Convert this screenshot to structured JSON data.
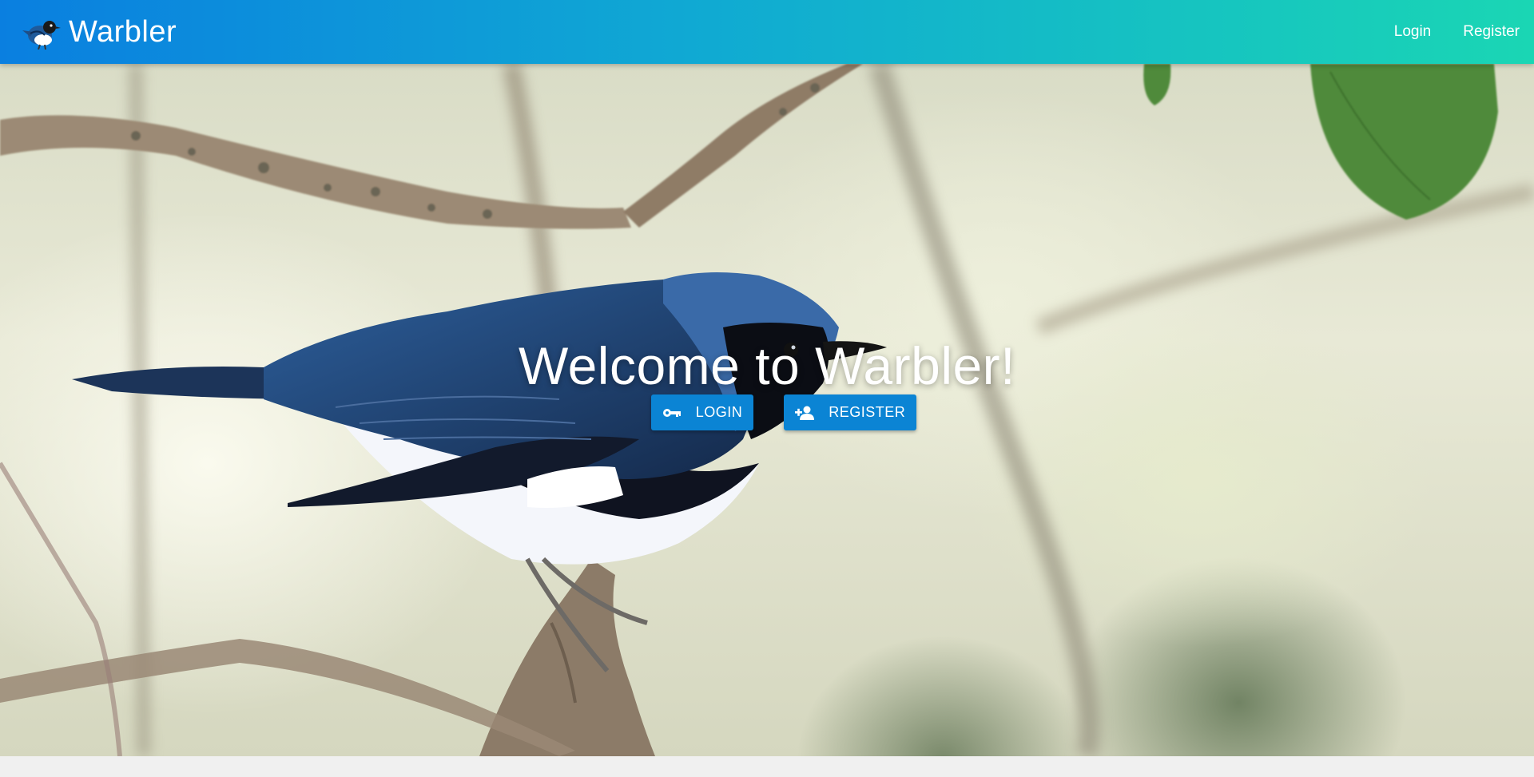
{
  "navbar": {
    "brand_name": "Warbler",
    "logo_icon": "warbler-bird-icon",
    "links": [
      {
        "label": "Login"
      },
      {
        "label": "Register"
      }
    ],
    "colors": {
      "gradient_start": "#0a7fe0",
      "gradient_end": "#1ad6b4"
    }
  },
  "hero": {
    "title": "Welcome to Warbler!",
    "background_image": "black-throated-blue-warbler-on-branch",
    "buttons": {
      "login": {
        "label": "LOGIN",
        "icon": "key-icon"
      },
      "register": {
        "label": "REGISTER",
        "icon": "person-add-icon"
      }
    },
    "button_color": "#0b84d4"
  }
}
